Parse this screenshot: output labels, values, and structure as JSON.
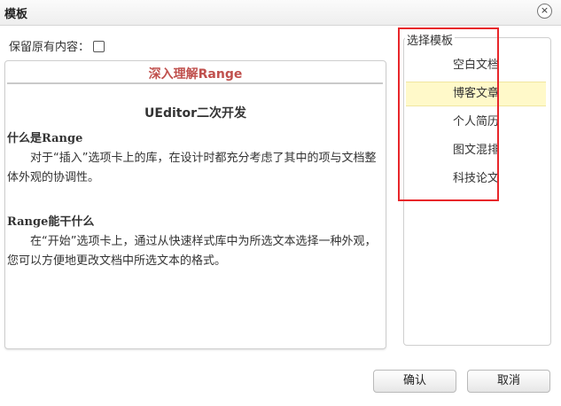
{
  "dialog": {
    "title": "模板",
    "close_symbol": "×"
  },
  "preserve": {
    "label": "保留原有内容：",
    "checked": false
  },
  "preview": {
    "title": "深入理解Range",
    "subtitle": "UEditor二次开发",
    "sections": [
      {
        "heading": "什么是Range",
        "body": "对于“插入”选项卡上的库，在设计时都充分考虑了其中的项与文档整体外观的协调性。"
      },
      {
        "heading": "Range能干什么",
        "body": "在“开始”选项卡上，通过从快速样式库中为所选文本选择一种外观，您可以方便地更改文档中所选文本的格式。"
      }
    ]
  },
  "templates": {
    "legend": "选择模板",
    "selected_index": 1,
    "items": [
      {
        "label": "空白文档"
      },
      {
        "label": "博客文章"
      },
      {
        "label": "个人简历"
      },
      {
        "label": "图文混排"
      },
      {
        "label": "科技论文"
      }
    ]
  },
  "buttons": {
    "ok": "确认",
    "cancel": "取消"
  },
  "colors": {
    "preview_title": "#c0504d",
    "selected_bg": "#fff9c9",
    "highlight_box": "#e8262a"
  }
}
